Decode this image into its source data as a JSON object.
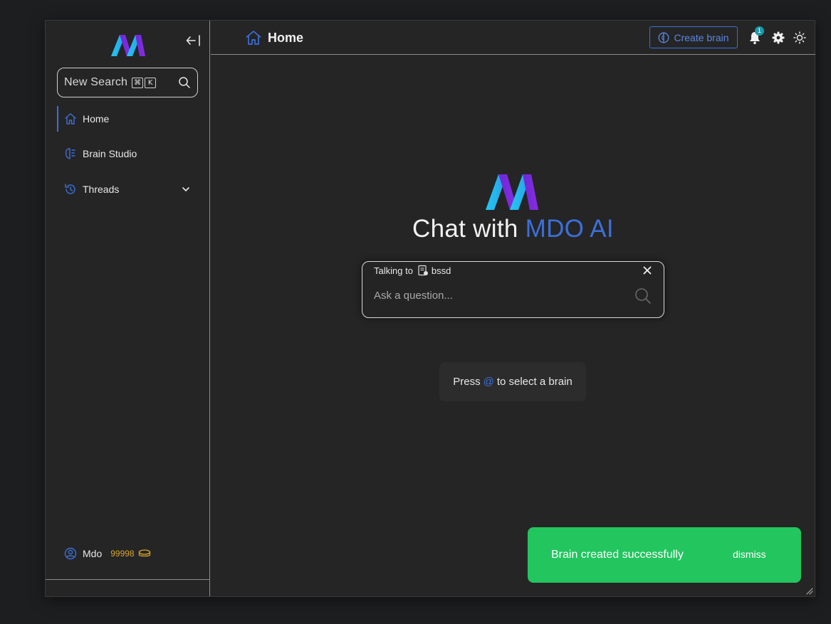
{
  "sidebar": {
    "search": {
      "label": "New Search",
      "keys": [
        "⌘",
        "K"
      ]
    },
    "items": [
      {
        "label": "Home",
        "icon": "home-icon",
        "active": true
      },
      {
        "label": "Brain Studio",
        "icon": "brain-studio-icon",
        "active": false
      },
      {
        "label": "Threads",
        "icon": "history-icon",
        "active": false
      }
    ],
    "user": {
      "name": "Mdo",
      "credits": "99998"
    }
  },
  "topbar": {
    "breadcrumb": "Home",
    "create_brain_label": "Create brain",
    "notification_count": "1"
  },
  "main": {
    "hero_prefix": "Chat with ",
    "hero_accent": "MDO AI",
    "chat": {
      "talking_to_label": "Talking to",
      "brain_name": "bssd",
      "placeholder": "Ask a question..."
    },
    "hint": {
      "prefix": "Press",
      "key": "@",
      "suffix": "to select a brain"
    }
  },
  "toast": {
    "message": "Brain created successfully",
    "dismiss_label": "dismiss"
  },
  "colors": {
    "accent": "#3d6fd9",
    "success": "#22c55e",
    "credits": "#d9a62a",
    "badge": "#1b9aa8"
  }
}
